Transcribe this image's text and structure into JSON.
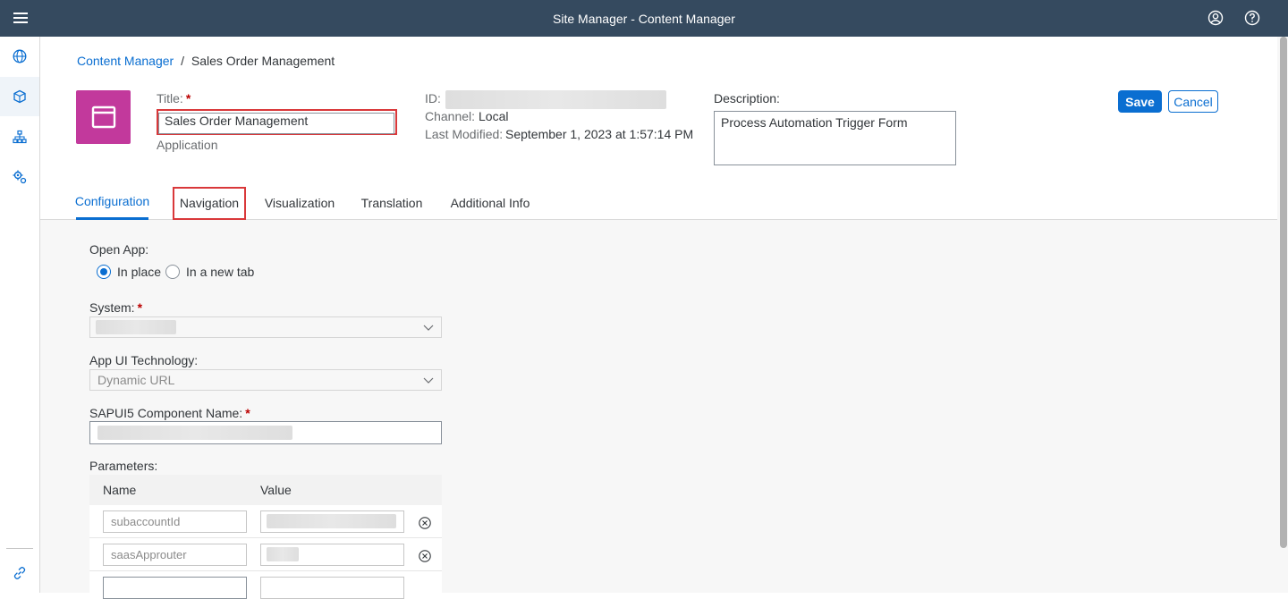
{
  "shell": {
    "title": "Site Manager - Content Manager"
  },
  "sidenav": {
    "items": [
      "globe-icon",
      "cube-icon",
      "hierarchy-icon",
      "settings-icon",
      "link-icon"
    ]
  },
  "breadcrumb": {
    "link": "Content Manager",
    "separator": "/",
    "current": "Sales Order Management"
  },
  "header": {
    "title_label": "Title:",
    "title_value": "Sales Order Management",
    "type": "Application",
    "id_label": "ID:",
    "channel_label": "Channel:",
    "channel_value": "Local",
    "modified_label": "Last Modified:",
    "modified_value": "September 1, 2023 at 1:57:14 PM",
    "description_label": "Description:",
    "description_value": "Process Automation Trigger Form",
    "save_label": "Save",
    "cancel_label": "Cancel",
    "required_mark": "*"
  },
  "tabs": [
    "Configuration",
    "Navigation",
    "Visualization",
    "Translation",
    "Additional Info"
  ],
  "form": {
    "open_app_label": "Open App:",
    "open_in_place": "In place",
    "open_new_tab": "In a new tab",
    "system_label": "System:",
    "ui_tech_label": "App UI Technology:",
    "ui_tech_value": "Dynamic URL",
    "component_label": "SAPUI5 Component Name:",
    "parameters_label": "Parameters:",
    "param_col_name": "Name",
    "param_col_value": "Value",
    "params": [
      {
        "name_placeholder": "subaccountId"
      },
      {
        "name_placeholder": "saasApprouter"
      }
    ]
  },
  "colors": {
    "shell": "#354a5f",
    "accent": "#0a6ed1",
    "highlight": "#d9383a",
    "app_icon": "#c2399c"
  }
}
